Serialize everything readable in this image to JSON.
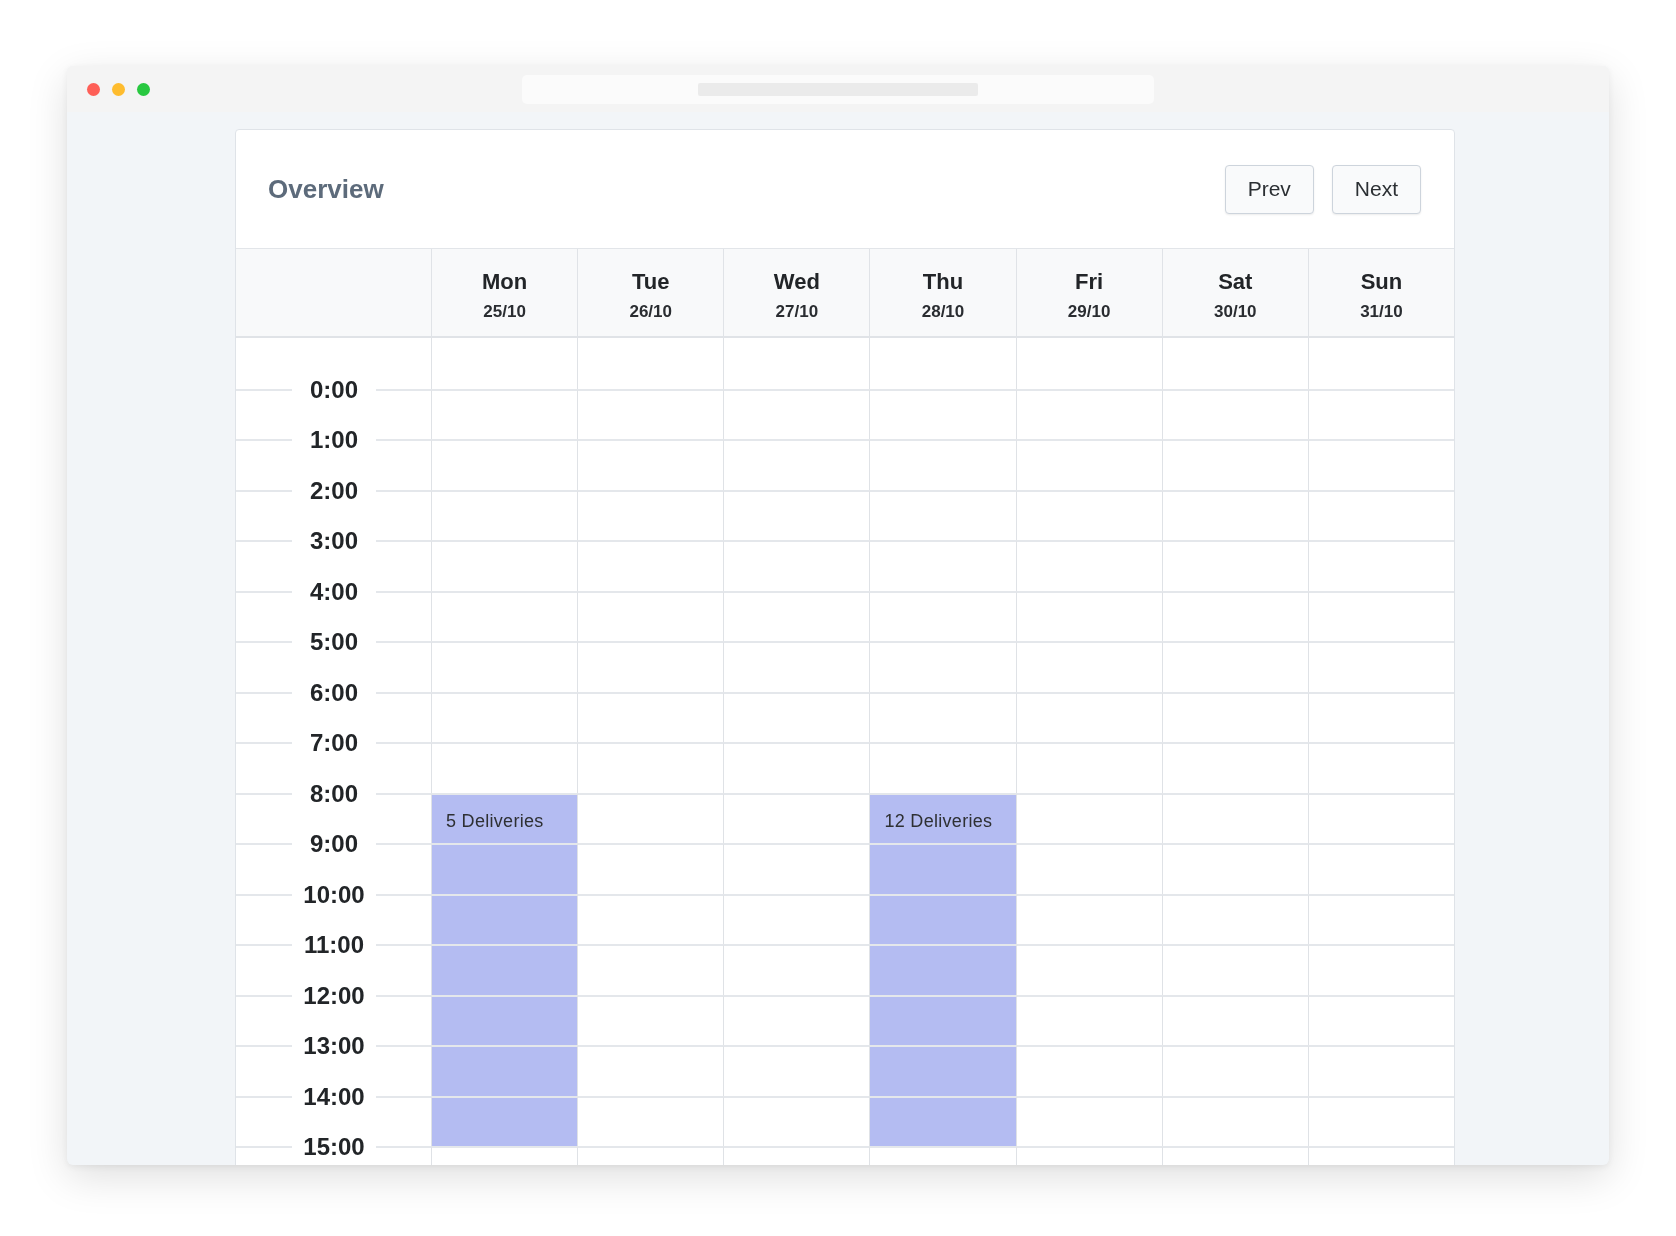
{
  "calendar": {
    "title": "Overview",
    "buttons": [
      {
        "label": "Prev"
      },
      {
        "label": "Next"
      }
    ],
    "days": [
      {
        "name": "Mon",
        "date": "25/10",
        "event": "5 Deliveries"
      },
      {
        "name": "Tue",
        "date": "26/10"
      },
      {
        "name": "Wed",
        "date": "27/10"
      },
      {
        "name": "Thu",
        "date": "28/10",
        "event": "12 Deliveries"
      },
      {
        "name": "Fri",
        "date": "29/10"
      },
      {
        "name": "Sat",
        "date": "30/10"
      },
      {
        "name": "Sun",
        "date": "31/10"
      }
    ],
    "hours": [
      {
        "label": "0:00",
        "booked": [
          false,
          false,
          false,
          false,
          false,
          false,
          false
        ]
      },
      {
        "label": "1:00",
        "booked": [
          false,
          false,
          false,
          false,
          false,
          false,
          false
        ]
      },
      {
        "label": "2:00",
        "booked": [
          false,
          false,
          false,
          false,
          false,
          false,
          false
        ]
      },
      {
        "label": "3:00",
        "booked": [
          false,
          false,
          false,
          false,
          false,
          false,
          false
        ]
      },
      {
        "label": "4:00",
        "booked": [
          false,
          false,
          false,
          false,
          false,
          false,
          false
        ]
      },
      {
        "label": "5:00",
        "booked": [
          false,
          false,
          false,
          false,
          false,
          false,
          false
        ]
      },
      {
        "label": "6:00",
        "booked": [
          false,
          false,
          false,
          false,
          false,
          false,
          false
        ]
      },
      {
        "label": "7:00",
        "booked": [
          false,
          false,
          false,
          false,
          false,
          false,
          false
        ]
      },
      {
        "label": "8:00",
        "booked": [
          true,
          false,
          false,
          true,
          false,
          false,
          false
        ]
      },
      {
        "label": "9:00",
        "booked": [
          true,
          false,
          false,
          true,
          false,
          false,
          false
        ]
      },
      {
        "label": "10:00",
        "booked": [
          true,
          false,
          false,
          true,
          false,
          false,
          false
        ]
      },
      {
        "label": "11:00",
        "booked": [
          true,
          false,
          false,
          true,
          false,
          false,
          false
        ]
      },
      {
        "label": "12:00",
        "booked": [
          true,
          false,
          false,
          true,
          false,
          false,
          false
        ]
      },
      {
        "label": "13:00",
        "booked": [
          true,
          false,
          false,
          true,
          false,
          false,
          false
        ]
      },
      {
        "label": "14:00",
        "booked": [
          true,
          false,
          false,
          true,
          false,
          false,
          false
        ]
      },
      {
        "label": "15:00",
        "booked": [
          false,
          false,
          false,
          false,
          false,
          false,
          false
        ]
      }
    ]
  }
}
